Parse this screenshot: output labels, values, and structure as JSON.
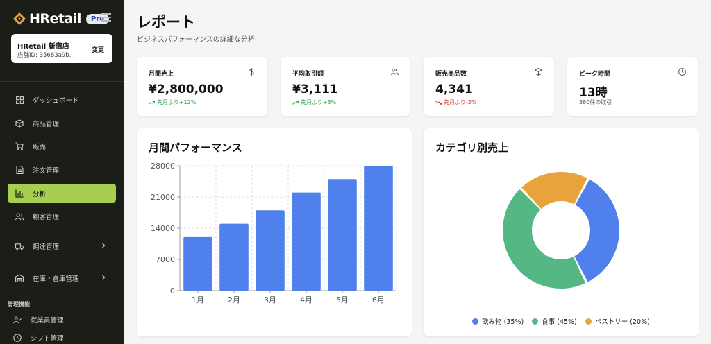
{
  "brand": {
    "name": "HRetail",
    "badge": "Pro"
  },
  "store": {
    "name": "HRetail 新宿店",
    "id": "店舗ID: 35683a9b...",
    "change_label": "変更"
  },
  "nav": {
    "items": [
      {
        "label": "ダッシュボード",
        "icon": "grid-icon"
      },
      {
        "label": "商品管理",
        "icon": "box-icon"
      },
      {
        "label": "販売",
        "icon": "cart-icon"
      },
      {
        "label": "注文管理",
        "icon": "document-icon"
      },
      {
        "label": "分析",
        "icon": "bar-chart-icon",
        "active": true
      },
      {
        "label": "顧客管理",
        "icon": "users-icon"
      },
      {
        "label": "調達管理",
        "icon": "truck-icon",
        "expandable": true
      },
      {
        "label": "在庫・倉庫管理",
        "icon": "warehouse-icon",
        "expandable": true
      }
    ],
    "section_label": "管理機能",
    "admin_items": [
      {
        "label": "従業員管理",
        "icon": "user-check-icon"
      },
      {
        "label": "シフト管理",
        "icon": "clock-icon"
      }
    ]
  },
  "page": {
    "title": "レポート",
    "subtitle": "ビジネスパフォーマンスの詳細な分析"
  },
  "stats": [
    {
      "label": "月間売上",
      "value": "¥2,800,000",
      "sub": "先月より+12%",
      "trend": "up",
      "icon": "dollar-icon"
    },
    {
      "label": "平均取引額",
      "value": "¥3,111",
      "sub": "先月より+3%",
      "trend": "up",
      "icon": "users-icon"
    },
    {
      "label": "販売商品数",
      "value": "4,341",
      "sub": "先月より-2%",
      "trend": "down",
      "icon": "package-icon"
    },
    {
      "label": "ピーク時間",
      "value": "13時",
      "sub": "380件の取引",
      "trend": "none",
      "icon": "clock-icon"
    }
  ],
  "colors": {
    "accent": "#a6cf52",
    "bar": "#4f80ec",
    "up": "#2f9a4a",
    "down": "#d43a2a",
    "sidebar": "#1b1d17"
  },
  "chart_data": [
    {
      "type": "bar",
      "title": "月間パフォーマンス",
      "categories": [
        "1月",
        "2月",
        "3月",
        "4月",
        "5月",
        "6月"
      ],
      "values": [
        12000,
        15000,
        18000,
        22000,
        25000,
        28000
      ],
      "yticks": [
        0,
        7000,
        14000,
        21000,
        28000
      ],
      "ylim": [
        0,
        28000
      ],
      "grid": true
    },
    {
      "type": "pie",
      "title": "カテゴリ別売上",
      "labels": [
        "飲み物 (35%)",
        "食事 (45%)",
        "ペストリー (20%)"
      ],
      "values": [
        35,
        45,
        20
      ],
      "colors": [
        "#4f80ec",
        "#55b884",
        "#e8a33d"
      ],
      "legend": "bottom"
    }
  ]
}
